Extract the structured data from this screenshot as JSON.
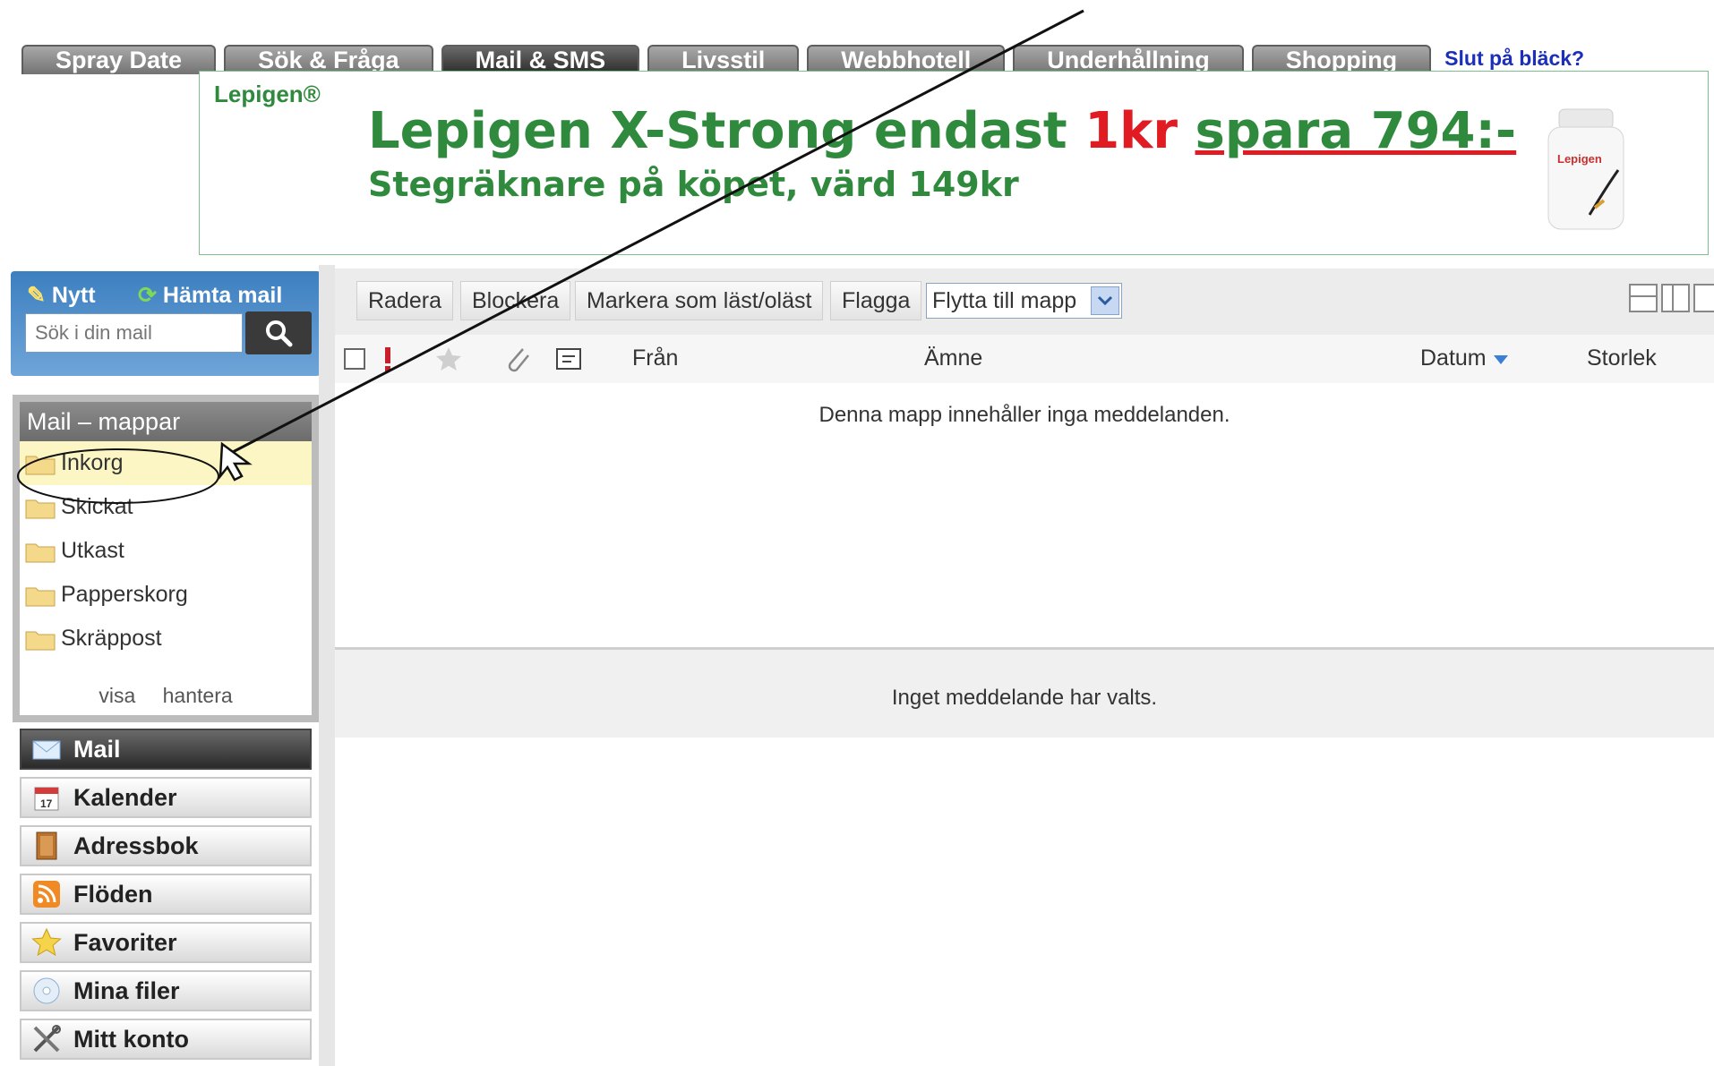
{
  "tabs": [
    "Spray Date",
    "Sök & Fråga",
    "Mail & SMS",
    "Livsstil",
    "Webbhotell",
    "Underhållning",
    "Shopping"
  ],
  "tab_link": "Slut på bläck?",
  "banner": {
    "logo": "Lepigen®",
    "headline_a": "Lepigen X-Strong endast ",
    "headline_price": "1kr",
    "headline_save": "spara 794:-",
    "subline": "Stegräknare  på köpet, värd 149kr",
    "product_label": "Lepigen"
  },
  "quick": {
    "new": "Nytt",
    "fetch": "Hämta mail",
    "search_placeholder": "Sök i din mail"
  },
  "folders": {
    "title": "Mail – mappar",
    "items": [
      "Inkorg",
      "Skickat",
      "Utkast",
      "Papperskorg",
      "Skräppost"
    ],
    "show": "visa",
    "manage": "hantera"
  },
  "nav": [
    "Mail",
    "Kalender",
    "Adressbok",
    "Flöden",
    "Favoriter",
    "Mina filer",
    "Mitt konto"
  ],
  "calendar_day": "17",
  "toolbar": {
    "delete": "Radera",
    "block": "Blockera",
    "mark": "Markera som läst/oläst",
    "flag": "Flagga",
    "move": "Flytta till mapp"
  },
  "columns": {
    "from": "Från",
    "subject": "Ämne",
    "date": "Datum",
    "size": "Storlek"
  },
  "list_empty": "Denna mapp innehåller inga meddelanden.",
  "preview_empty": "Inget meddelande har valts.",
  "colors": {
    "tab": "#8a8a8a",
    "tab_active": "#3a3a3a",
    "brand_green": "#2f8a3d",
    "price_red": "#e01b22",
    "link_blue": "#1b2fb8"
  }
}
